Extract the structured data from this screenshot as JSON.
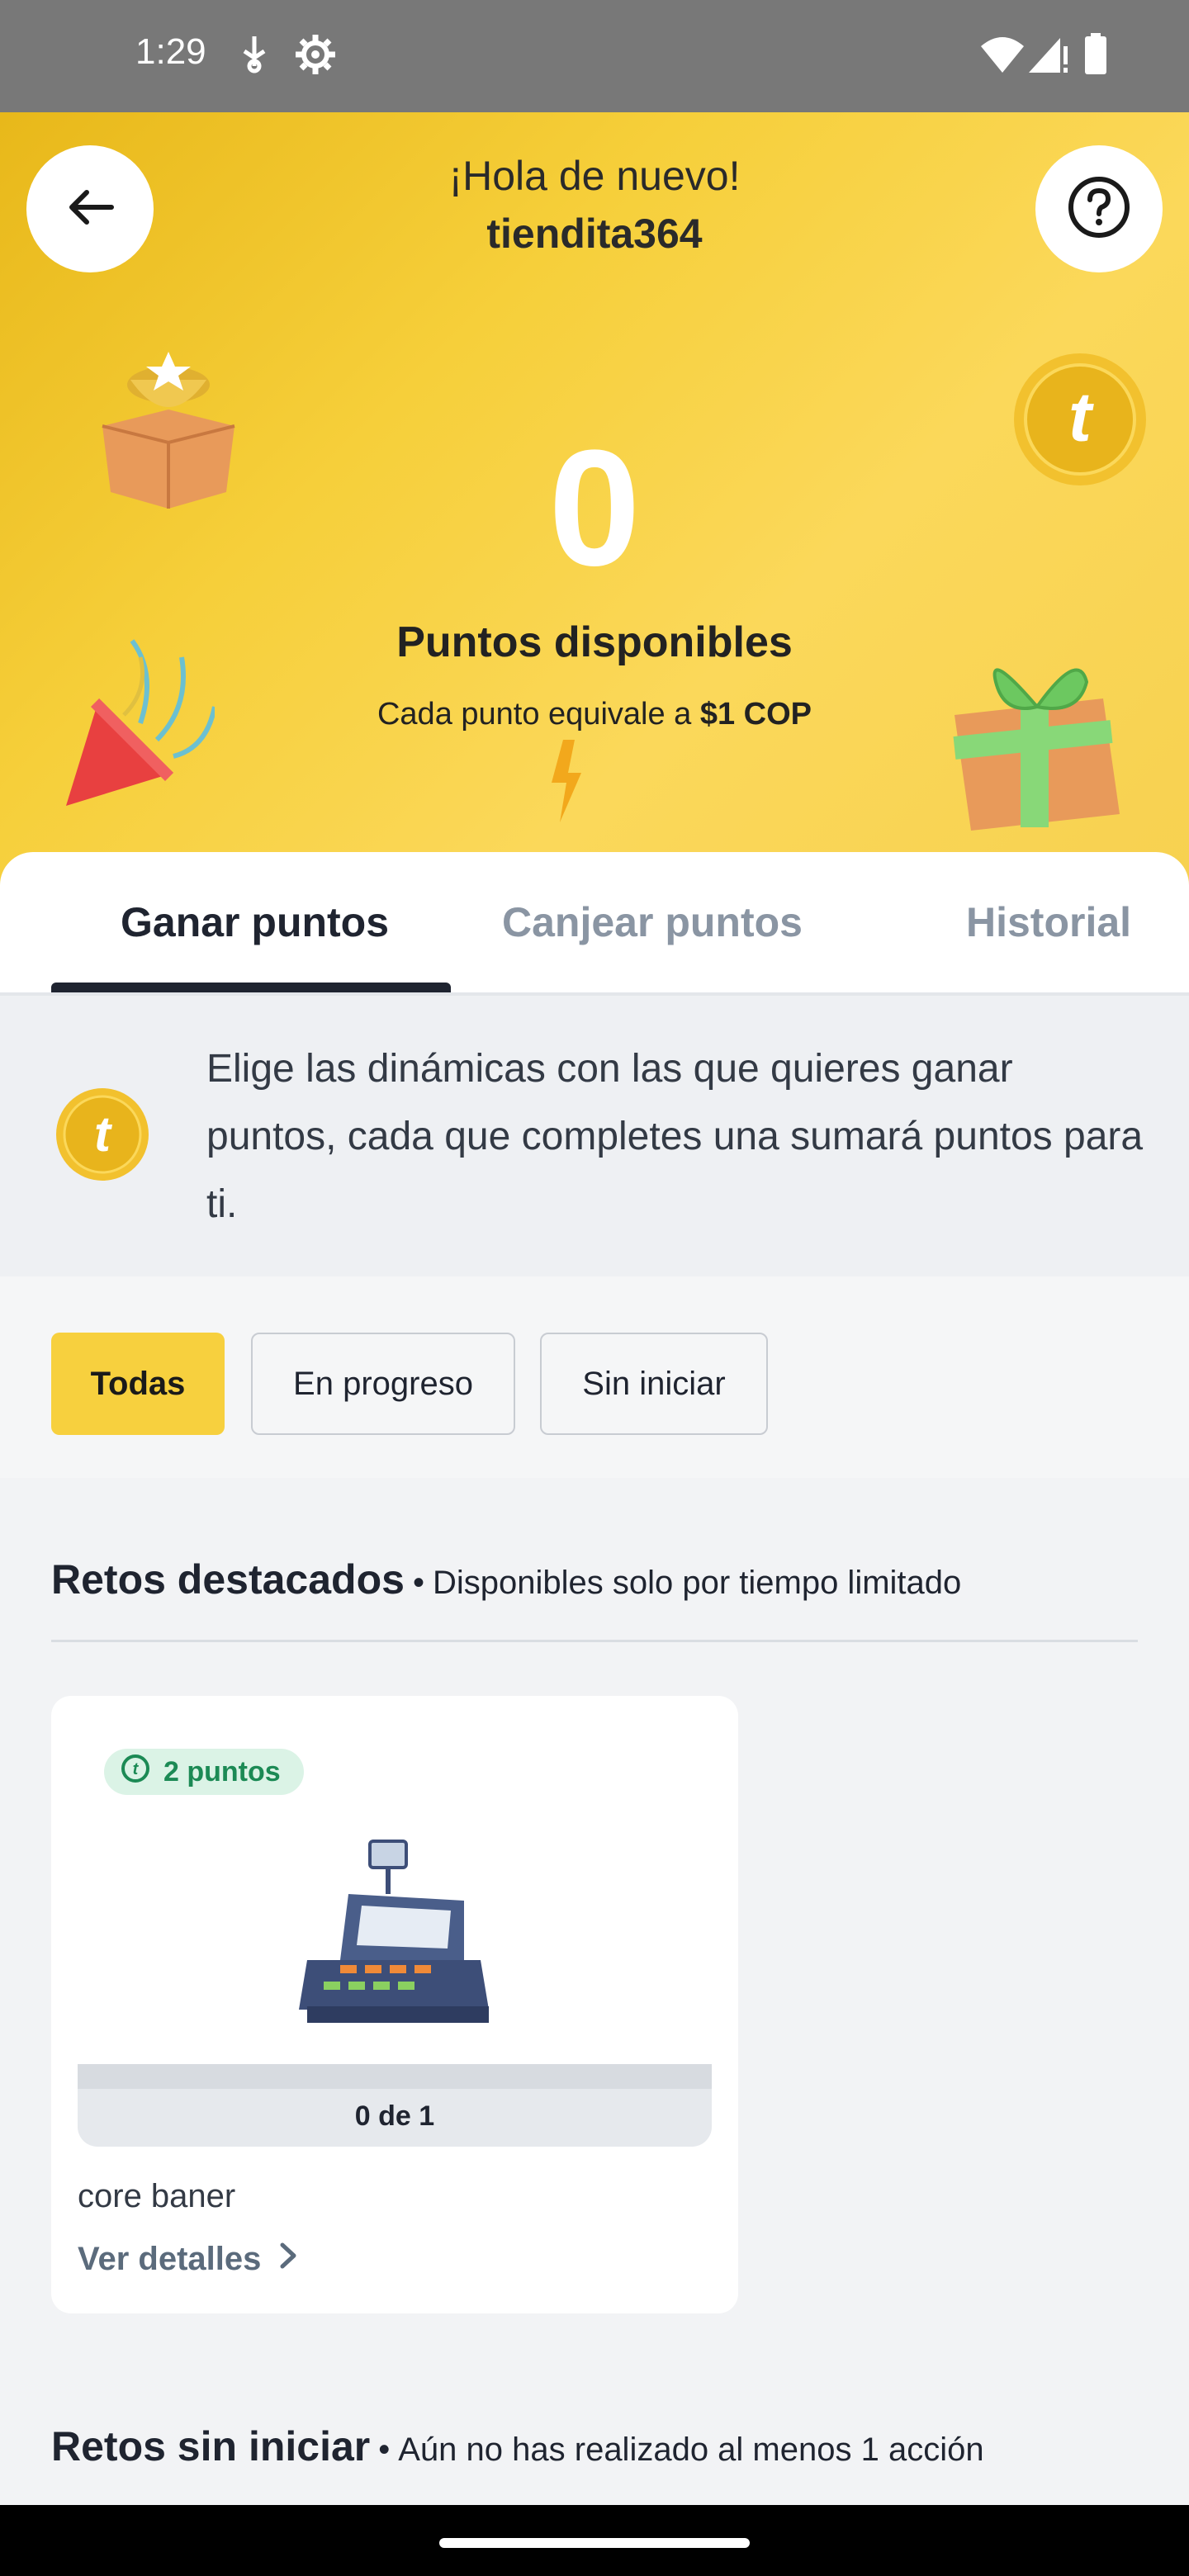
{
  "status_bar": {
    "time": "1:29",
    "left_icons": [
      "usb-debug-icon",
      "gear-icon"
    ],
    "right_icons": [
      "wifi-icon",
      "signal-icon",
      "battery-icon"
    ]
  },
  "header": {
    "greeting": "¡Hola de nuevo!",
    "username": "tiendita364",
    "points_value": "0",
    "points_label": "Puntos disponibles",
    "points_desc_prefix": "Cada punto equivale a ",
    "points_desc_value": "$1 COP",
    "accent_color": "#f6cf3a"
  },
  "tabs": [
    {
      "label": "Ganar puntos",
      "active": true
    },
    {
      "label": "Canjear puntos",
      "active": false
    },
    {
      "label": "Historial",
      "active": false
    }
  ],
  "intro": {
    "text": "Elige las dinámicas con las que quieres ganar puntos, cada que completes una sumará puntos para ti."
  },
  "filters": [
    {
      "label": "Todas",
      "active": true
    },
    {
      "label": "En progreso",
      "active": false
    },
    {
      "label": "Sin iniciar",
      "active": false
    }
  ],
  "featured": {
    "title": "Retos destacados",
    "subtitle": "Disponibles solo por tiempo limitado",
    "card": {
      "badge": "2 puntos",
      "progress_label": "0 de 1",
      "progress_fraction": 0,
      "name": "core baner",
      "link": "Ver detalles"
    }
  },
  "not_started": {
    "title": "Retos sin iniciar",
    "subtitle": "Aún no has realizado al menos 1 acción"
  }
}
